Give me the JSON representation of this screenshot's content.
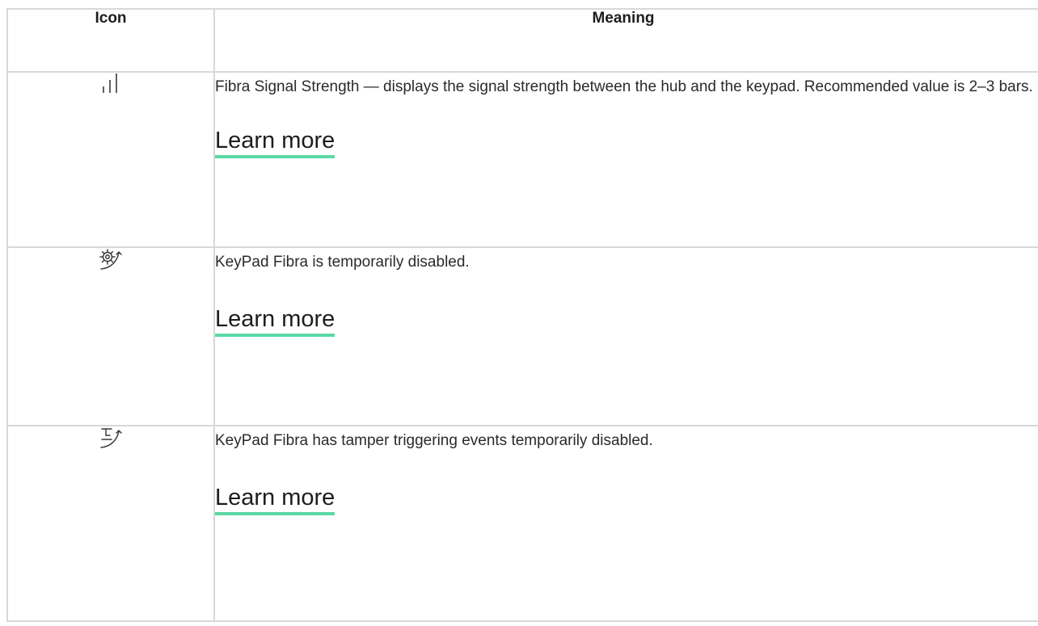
{
  "table": {
    "headers": {
      "icon": "Icon",
      "meaning": "Meaning"
    },
    "rows": [
      {
        "icon": "signal-strength-icon",
        "description": "Fibra Signal Strength — displays the signal strength between the hub and the keypad. Recommended value is 2–3 bars.",
        "link": "Learn more"
      },
      {
        "icon": "gear-disabled-icon",
        "description": "KeyPad Fibra is temporarily disabled.",
        "link": "Learn more"
      },
      {
        "icon": "tamper-disabled-icon",
        "description": "KeyPad Fibra has tamper triggering events temporarily disabled.",
        "link": "Learn more"
      }
    ]
  },
  "colors": {
    "link_underline": "#5ad9a4",
    "border": "#d8d8d8",
    "text": "#1d1d1f"
  }
}
